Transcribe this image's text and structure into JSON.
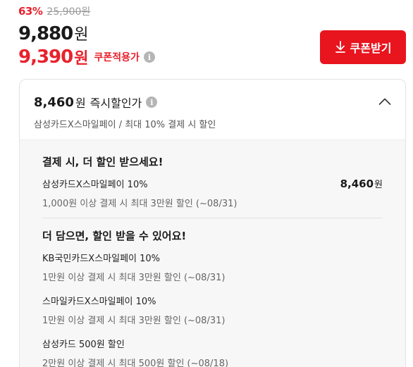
{
  "price": {
    "discount_rate": "63%",
    "original_price": "25,900원",
    "sale_price": "9,880",
    "sale_unit": "원",
    "coupon_price": "9,390",
    "coupon_unit": "원",
    "coupon_label": "쿠폰적용가"
  },
  "coupon_button": {
    "label": "쿠폰받기",
    "icon": "download-icon",
    "color": "#e8141e"
  },
  "instant_discount": {
    "price": "8,460",
    "unit": "원",
    "label": "즉시할인가",
    "subtitle": "삼성카드X스마일페이 / 최대 10% 결제 시 할인"
  },
  "payment_section": {
    "title": "결제 시, 더 할인 받으세요!",
    "offers": [
      {
        "name": "삼성카드X스마일페이 10%",
        "desc": "1,000원 이상 결제 시 최대 3만원 할인 (~08/31)",
        "price": "8,460",
        "unit": "원"
      }
    ]
  },
  "more_section": {
    "title": "더 담으면, 할인 받을 수 있어요!",
    "offers": [
      {
        "name": "KB국민카드X스마일페이 10%",
        "desc": "1만원 이상 결제 시 최대 3만원 할인 (~08/31)"
      },
      {
        "name": "스마일카드X스마일페이 10%",
        "desc": "1만원 이상 결제 시 최대 3만원 할인 (~08/31)"
      },
      {
        "name": "삼성카드 500원 할인",
        "desc": "2만원 이상 결제 시 최대 500원 할인 (~08/18)"
      }
    ]
  },
  "colors": {
    "accent": "#e8222d",
    "text": "#1a1a1a",
    "muted": "#9a9a9a",
    "panel_bg": "#f7f7f7"
  }
}
